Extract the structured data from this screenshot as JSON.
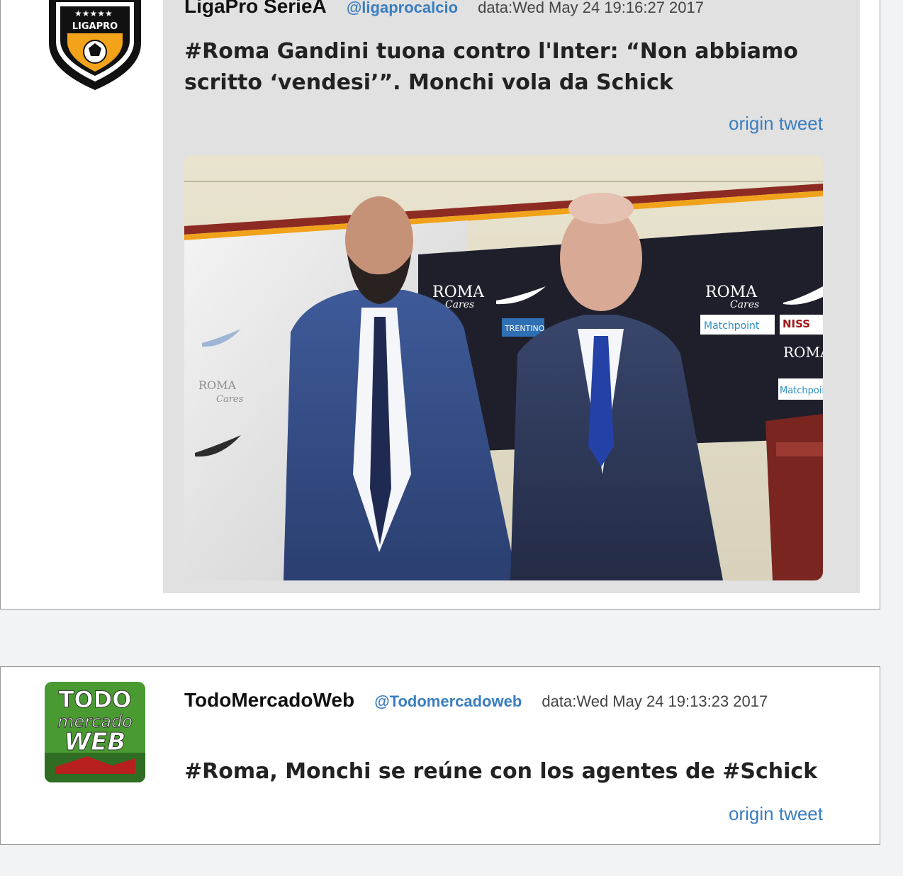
{
  "tweets": [
    {
      "name": "LigaPro SerieA",
      "handle": "@ligaprocalcio",
      "date": "data:Wed May 24 19:16:27 2017",
      "text": "#Roma Gandini tuona contro l'Inter: “Non abbiamo scritto ‘vendesi’”. Monchi vola da Schick",
      "origin_label": "origin tweet",
      "logo_text": "LIGAPRO"
    },
    {
      "name": "TodoMercadoWeb",
      "handle": "@Todomercadoweb",
      "date": "data:Wed May 24 19:13:23 2017",
      "text": "#Roma, Monchi se reúne con los agentes de #Schick",
      "origin_label": "origin tweet",
      "logo_text": {
        "line1": "TODO",
        "line2": "mercado",
        "line3": "WEB"
      }
    }
  ],
  "photo": {
    "sponsor_roma": "ROMA",
    "sponsor_cares": "Cares",
    "sponsor_matchpoint": "Matchpoint",
    "sponsor_niss": "NISS",
    "sponsor_trentino": "TRENTINO"
  },
  "colors": {
    "link": "#3a7dc0",
    "card_border": "#9a9a9a",
    "quote_bg": "#e1e1e1",
    "page_bg": "#f2f3f4"
  }
}
